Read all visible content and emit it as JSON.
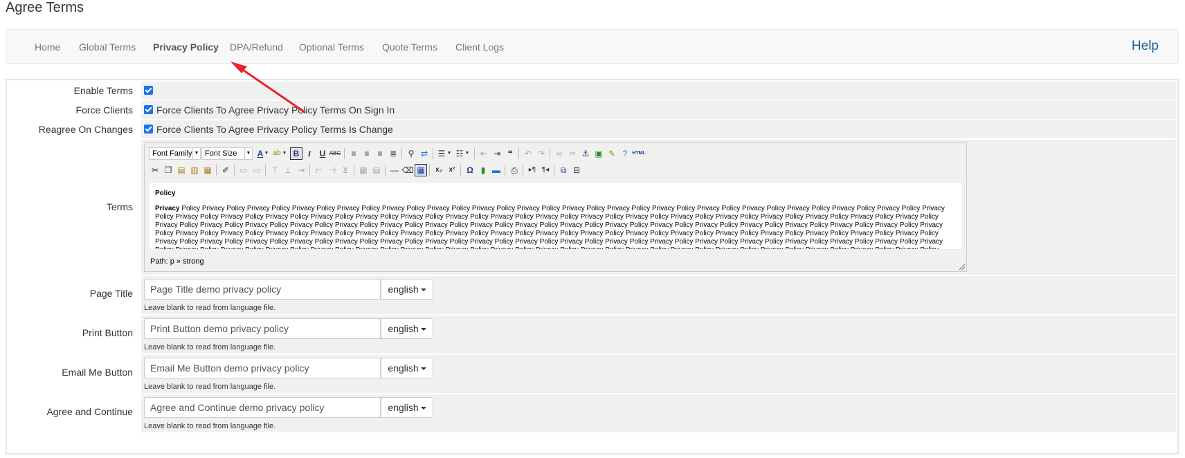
{
  "page": {
    "title": "Agree Terms"
  },
  "nav": {
    "items": [
      {
        "label": "Home"
      },
      {
        "label": "Global Terms"
      },
      {
        "label": "Privacy Policy",
        "active": true
      },
      {
        "label": "DPA/Refund"
      },
      {
        "label": "Optional Terms"
      },
      {
        "label": "Quote Terms"
      },
      {
        "label": "Client Logs"
      }
    ],
    "help_label": "Help"
  },
  "form": {
    "enable_terms": {
      "label": "Enable Terms",
      "checked": true
    },
    "force_clients": {
      "label": "Force Clients",
      "checked": true,
      "text": "Force Clients To Agree Privacy Policy Terms On Sign In"
    },
    "reagree": {
      "label": "Reagree On Changes",
      "checked": true,
      "text": "Force Clients To Agree Privacy Policy Terms Is Change"
    },
    "terms": {
      "label": "Terms",
      "toolbar": {
        "font_family": "Font Family",
        "font_size": "Font Size",
        "html_label": "HTML"
      },
      "heading": "Policy",
      "body_strong": "Privacy",
      "body_text": "Policy Privacy Policy Privacy Policy Privacy Policy Privacy Policy Privacy Policy Privacy Policy Privacy Policy Privacy Policy Privacy Policy Privacy Policy Privacy Policy Privacy Policy Privacy Policy Privacy Policy Privacy Policy Privacy Policy Privacy Policy Privacy Policy Privacy Policy Privacy Policy Privacy Policy Privacy Policy Privacy Policy Privacy Policy Privacy Policy Privacy Policy Privacy Policy Privacy Policy Privacy Policy Privacy Policy Privacy Policy Privacy Policy Privacy Policy Privacy Policy Privacy Policy Privacy Policy Privacy Policy Privacy Policy Privacy Policy Privacy Policy Privacy Policy Privacy Policy Privacy Policy Privacy Policy Privacy Policy Privacy Policy Privacy Policy Privacy Policy Privacy Policy Privacy Policy Privacy Policy Privacy Policy Privacy Policy Privacy Policy Privacy Policy Privacy Policy Privacy Policy Privacy Policy Privacy Policy Privacy Policy Privacy Policy Privacy Policy Privacy Policy Privacy Policy Privacy Policy Privacy Policy Privacy Policy Privacy Policy Privacy Policy Privacy Policy Privacy Policy Privacy Policy Privacy Policy Privacy Policy Privacy Policy Privacy Policy Privacy Policy Privacy Policy Privacy Policy Privacy Policy Privacy Policy Privacy Policy Privacy Policy Privacy Policy Privacy Policy Privacy Policy Privacy Policy Privacy Policy Privacy Policy Privacy Policy Privacy Policy Privacy Policy Privacy Policy Privacy Policy Privacy Policy Privacy Policy Privacy Policy Privacy Policy Privacy Policy Privacy Policy Privacy Policy Privacy Policy Privacy Policy Privacy Policy Privacy Policy Privacy Policy Privacy Policy Privacy Policy Privacy Policy Privacy Policy Privacy Policy Privacy Policy Privacy Policy Privacy Policy Privacy Policy Privacy Policy Privacy Policy Privacy Policy",
      "path": "Path: p » strong"
    },
    "page_title": {
      "label": "Page Title",
      "value": "Page Title demo privacy policy",
      "lang": "english",
      "hint": "Leave blank to read from language file."
    },
    "print_button": {
      "label": "Print Button",
      "value": "Print Button demo privacy policy",
      "lang": "english",
      "hint": "Leave blank to read from language file."
    },
    "email_button": {
      "label": "Email Me Button",
      "value": "Email Me Button demo privacy policy",
      "lang": "english",
      "hint": "Leave blank to read from language file."
    },
    "agree_continue": {
      "label": "Agree and Continue",
      "value": "Agree and Continue demo privacy policy",
      "lang": "english",
      "hint": "Leave blank to read from language file."
    }
  },
  "colors": {
    "accent": "#1a73e8",
    "help": "#1c5f8a",
    "arrow": "#e8242a",
    "field_bg": "#f0f0f0"
  }
}
